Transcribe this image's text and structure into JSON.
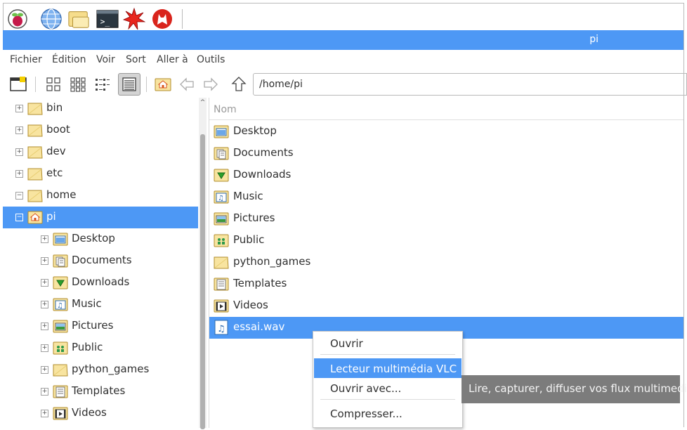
{
  "panel": {
    "launchers": [
      {
        "icon": "raspberry-menu-icon"
      },
      {
        "icon": "web-browser-icon"
      },
      {
        "icon": "file-manager-icon"
      },
      {
        "icon": "terminal-icon"
      },
      {
        "icon": "mathematica-icon"
      },
      {
        "icon": "wolfram-icon"
      }
    ]
  },
  "window": {
    "title": "pi"
  },
  "menubar": {
    "items": [
      "Fichier",
      "Édition",
      "Voir",
      "Sort",
      "Aller à",
      "Outils"
    ]
  },
  "toolbar": {
    "buttons": [
      {
        "icon": "new-window-icon"
      },
      {
        "icon": "icon-view-icon"
      },
      {
        "icon": "thumbnail-view-icon"
      },
      {
        "icon": "compact-view-icon"
      },
      {
        "icon": "detailed-list-view-icon"
      },
      {
        "icon": "home-icon"
      },
      {
        "icon": "back-arrow-icon"
      },
      {
        "icon": "forward-arrow-icon"
      },
      {
        "icon": "up-arrow-icon"
      }
    ],
    "path": "/home/pi"
  },
  "tree": {
    "items": [
      {
        "label": "bin",
        "level": 0,
        "expander": "+",
        "icon": "folder-icon"
      },
      {
        "label": "boot",
        "level": 0,
        "expander": "+",
        "icon": "folder-icon"
      },
      {
        "label": "dev",
        "level": 0,
        "expander": "+",
        "icon": "folder-icon"
      },
      {
        "label": "etc",
        "level": 0,
        "expander": "+",
        "icon": "folder-icon"
      },
      {
        "label": "home",
        "level": 0,
        "expander": "−",
        "icon": "folder-icon"
      },
      {
        "label": "pi",
        "level": 0,
        "expander": "−",
        "icon": "home-folder-icon",
        "selected": true
      },
      {
        "label": "Desktop",
        "level": 1,
        "expander": "+",
        "icon": "desktop-folder-icon"
      },
      {
        "label": "Documents",
        "level": 1,
        "expander": "+",
        "icon": "documents-folder-icon"
      },
      {
        "label": "Downloads",
        "level": 1,
        "expander": "+",
        "icon": "downloads-folder-icon"
      },
      {
        "label": "Music",
        "level": 1,
        "expander": "+",
        "icon": "music-folder-icon"
      },
      {
        "label": "Pictures",
        "level": 1,
        "expander": "+",
        "icon": "pictures-folder-icon"
      },
      {
        "label": "Public",
        "level": 1,
        "expander": "+",
        "icon": "public-folder-icon"
      },
      {
        "label": "python_games",
        "level": 1,
        "expander": "+",
        "icon": "folder-icon"
      },
      {
        "label": "Templates",
        "level": 1,
        "expander": "+",
        "icon": "templates-folder-icon"
      },
      {
        "label": "Videos",
        "level": 1,
        "expander": "+",
        "icon": "videos-folder-icon"
      }
    ]
  },
  "files": {
    "column_header": "Nom",
    "items": [
      {
        "label": "Desktop",
        "icon": "desktop-folder-icon"
      },
      {
        "label": "Documents",
        "icon": "documents-folder-icon"
      },
      {
        "label": "Downloads",
        "icon": "downloads-folder-icon"
      },
      {
        "label": "Music",
        "icon": "music-folder-icon"
      },
      {
        "label": "Pictures",
        "icon": "pictures-folder-icon"
      },
      {
        "label": "Public",
        "icon": "public-folder-icon"
      },
      {
        "label": "python_games",
        "icon": "folder-icon"
      },
      {
        "label": "Templates",
        "icon": "templates-folder-icon"
      },
      {
        "label": "Videos",
        "icon": "videos-folder-icon"
      },
      {
        "label": "essai.wav",
        "icon": "audio-file-icon",
        "selected": true
      }
    ]
  },
  "context_menu": {
    "items": [
      {
        "label": "Ouvrir"
      },
      {
        "label": "Lecteur multimédia VLC",
        "highlighted": true
      },
      {
        "label": "Ouvrir avec..."
      },
      {
        "label": "Compresser..."
      }
    ]
  },
  "tooltip": {
    "text": "Lire, capturer, diffuser vos flux multimedia"
  },
  "colors": {
    "accent": "#4d98f5",
    "folder": "#f8e4a0",
    "tooltip_bg": "#7c7c7c"
  }
}
